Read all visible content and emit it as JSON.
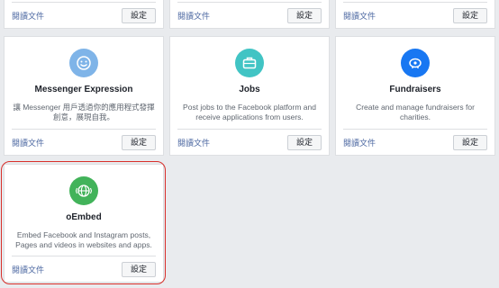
{
  "cards": [
    {
      "read_label": "閱讀文件",
      "settings_label": "設定"
    },
    {
      "read_label": "閱讀文件",
      "settings_label": "設定"
    },
    {
      "read_label": "閱讀文件",
      "settings_label": "設定"
    },
    {
      "title": "Messenger Expression",
      "description": "讓 Messenger 用戶透過你的應用程式發揮創意，展現自我。",
      "read_label": "閱讀文件",
      "settings_label": "設定",
      "icon": "smiley-bubble-icon",
      "icon_color": "#7fb4e8"
    },
    {
      "title": "Jobs",
      "description": "Post jobs to the Facebook platform and receive applications from users.",
      "read_label": "閱讀文件",
      "settings_label": "設定",
      "icon": "briefcase-icon",
      "icon_color": "#41c4c4"
    },
    {
      "title": "Fundraisers",
      "description": "Create and manage fundraisers for charities.",
      "read_label": "閱讀文件",
      "settings_label": "設定",
      "icon": "piggy-bank-icon",
      "icon_color": "#1877f2"
    },
    {
      "title": "oEmbed",
      "description": "Embed Facebook and Instagram posts, Pages and videos in websites and apps.",
      "read_label": "閱讀文件",
      "settings_label": "設定",
      "icon": "embed-globe-icon",
      "icon_color": "#42b35a"
    }
  ],
  "colors": {
    "highlight": "#d9302b",
    "link": "#4b67a1"
  }
}
